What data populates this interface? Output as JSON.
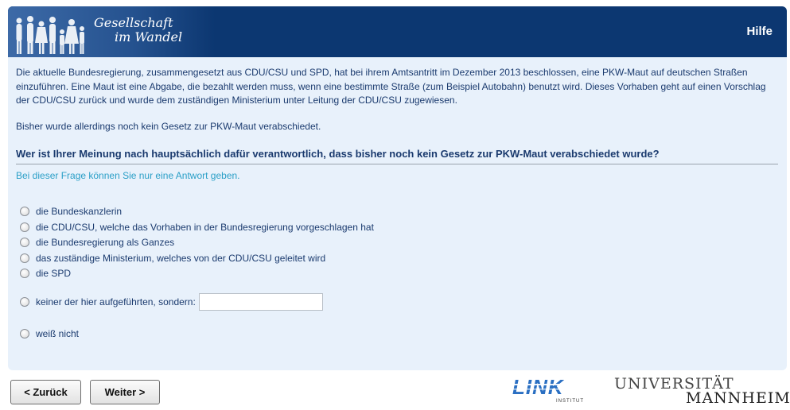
{
  "header": {
    "brand_line1": "Gesellschaft",
    "brand_line2": "im Wandel",
    "help_label": "Hilfe"
  },
  "intro": {
    "paragraph1": "Die aktuelle Bundesregierung, zusammengesetzt aus CDU/CSU und SPD, hat bei ihrem Amtsantritt im Dezember 2013 beschlossen, eine PKW-Maut auf deutschen Straßen einzuführen. Eine Maut ist eine Abgabe, die bezahlt werden muss, wenn eine bestimmte Straße (zum Beispiel Autobahn) benutzt wird. Dieses Vorhaben geht auf einen Vorschlag der CDU/CSU zurück und wurde dem zuständigen Ministerium unter Leitung der CDU/CSU zugewiesen.",
    "paragraph2": "Bisher wurde allerdings noch kein Gesetz zur PKW-Maut verabschiedet."
  },
  "question": {
    "text": "Wer ist Ihrer Meinung nach hauptsächlich dafür verantwortlich, dass bisher noch kein Gesetz zur PKW-Maut verabschiedet wurde?",
    "hint": "Bei dieser Frage können Sie nur eine Antwort geben.",
    "options": [
      "die Bundeskanzlerin",
      "die CDU/CSU, welche das Vorhaben in der Bundesregierung vorgeschlagen hat",
      "die Bundesregierung als Ganzes",
      "das zuständige Ministerium, welches von der CDU/CSU geleitet wird",
      "die SPD"
    ],
    "other_label": "keiner der hier aufgeführten, sondern:",
    "other_value": "",
    "dont_know_label": "weiß nicht"
  },
  "nav": {
    "back_label": "< Zurück",
    "next_label": "Weiter >"
  },
  "logos": {
    "link_text": "LINK",
    "link_sub": "INSTITUT",
    "uni_line1": "UNIVERSITÄT",
    "uni_line2": "MANNHEIM"
  },
  "colors": {
    "header_bg": "#0c3771",
    "panel_bg": "#e8f1fb",
    "text": "#1a3a6e",
    "hint": "#2a9fc7",
    "link_logo": "#2a6fc2"
  }
}
